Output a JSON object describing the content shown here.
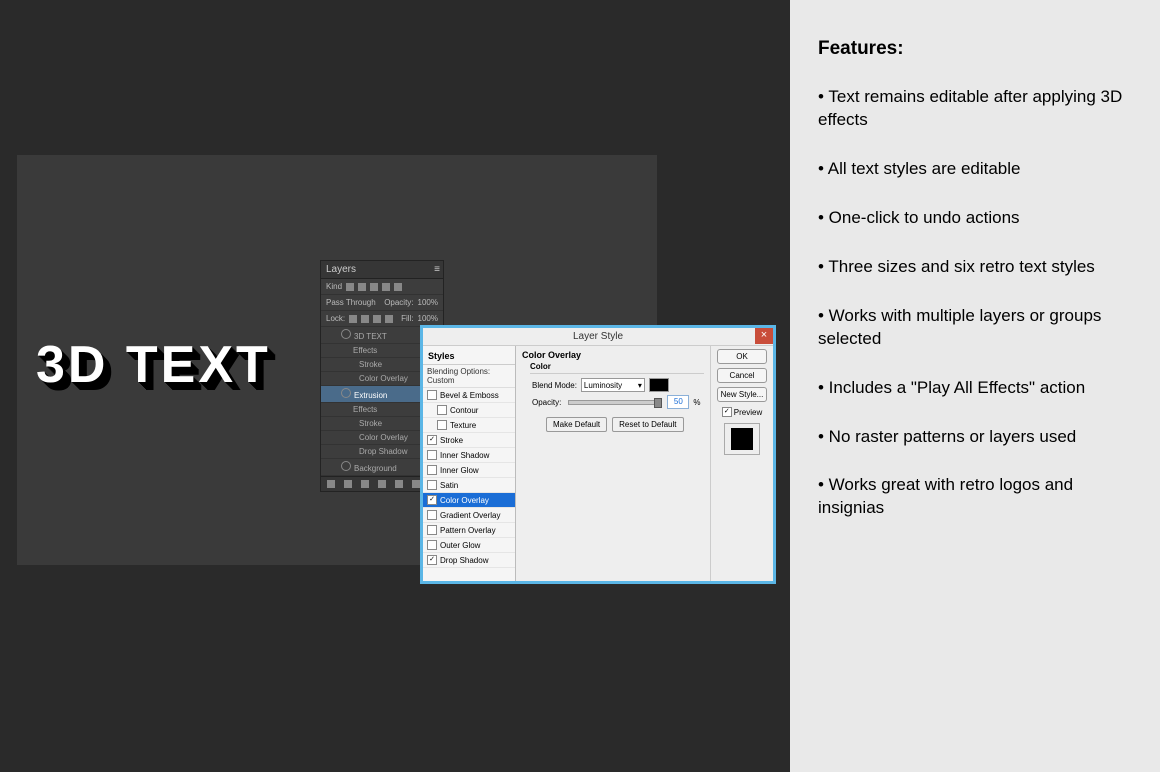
{
  "sidebar": {
    "title": "Features:",
    "items": [
      "• Text remains editable after applying 3D effects",
      "• All text styles are editable",
      "• One-click to undo actions",
      "• Three sizes and six retro text styles",
      "• Works with multiple layers or groups selected",
      "• Includes a \"Play All Effects\" action",
      "• No raster patterns or layers used",
      "• Works great with retro logos and insignias"
    ]
  },
  "canvas": {
    "text": "3D TEXT"
  },
  "layers_panel": {
    "title": "Layers",
    "kind": "Kind",
    "mode": "Pass Through",
    "opacity_label": "Opacity:",
    "opacity_value": "100%",
    "lock": "Lock:",
    "fill_label": "Fill:",
    "fill_value": "100%",
    "tree": [
      {
        "label": "3D TEXT"
      },
      {
        "label": "Effects",
        "ind": true
      },
      {
        "label": "Stroke",
        "ind2": true
      },
      {
        "label": "Color Overlay",
        "ind2": true
      },
      {
        "label": "Extrusion",
        "sel": true
      },
      {
        "label": "Effects",
        "ind": true
      },
      {
        "label": "Stroke",
        "ind2": true
      },
      {
        "label": "Color Overlay",
        "ind2": true
      },
      {
        "label": "Drop Shadow",
        "ind2": true
      },
      {
        "label": "Background"
      }
    ]
  },
  "dialog": {
    "title": "Layer Style",
    "left": {
      "styles_label": "Styles",
      "blending_label": "Blending Options: Custom",
      "options": [
        {
          "label": "Bevel & Emboss",
          "checked": false
        },
        {
          "label": "Contour",
          "checked": false
        },
        {
          "label": "Texture",
          "checked": false
        },
        {
          "label": "Stroke",
          "checked": true
        },
        {
          "label": "Inner Shadow",
          "checked": false
        },
        {
          "label": "Inner Glow",
          "checked": false
        },
        {
          "label": "Satin",
          "checked": false
        },
        {
          "label": "Color Overlay",
          "checked": true,
          "selected": true
        },
        {
          "label": "Gradient Overlay",
          "checked": false
        },
        {
          "label": "Pattern Overlay",
          "checked": false
        },
        {
          "label": "Outer Glow",
          "checked": false
        },
        {
          "label": "Drop Shadow",
          "checked": true
        }
      ]
    },
    "center": {
      "group": "Color Overlay",
      "subgroup": "Color",
      "blend_mode_label": "Blend Mode:",
      "blend_mode_value": "Luminosity",
      "opacity_label": "Opacity:",
      "opacity_value": "50",
      "opacity_unit": "%",
      "make_default": "Make Default",
      "reset_default": "Reset to Default"
    },
    "right": {
      "ok": "OK",
      "cancel": "Cancel",
      "new_style": "New Style...",
      "preview": "Preview"
    }
  }
}
